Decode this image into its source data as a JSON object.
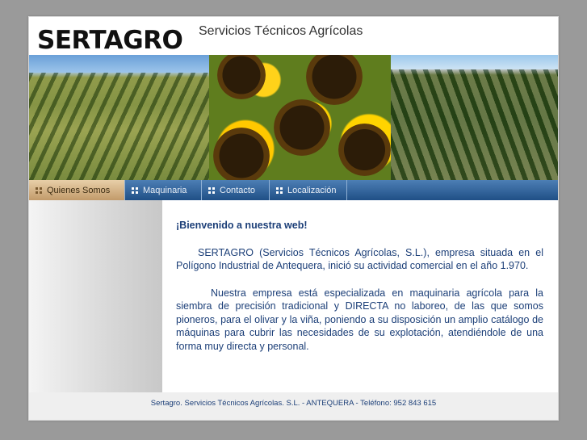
{
  "header": {
    "logo": "SERTAGRO",
    "tagline": "Servicios Técnicos Agrícolas"
  },
  "nav": {
    "items": [
      {
        "label": "Quienes Somos",
        "active": true
      },
      {
        "label": "Maquinaria",
        "active": false
      },
      {
        "label": "Contacto",
        "active": false
      },
      {
        "label": "Localización",
        "active": false
      }
    ]
  },
  "content": {
    "welcome": "¡Bienvenido a nuestra web!",
    "paragraph1": "SERTAGRO (Servicios Técnicos Agrícolas, S.L.), empresa situada en el Polígono Industrial de Antequera, inició su actividad comercial en el año 1.970.",
    "paragraph2": "Nuestra empresa está especializada en maquinaria agrícola para la siembra de precisión tradicional y DIRECTA no laboreo, de las que somos pioneros, para el olivar y la viña, poniendo a su disposición un amplio catálogo de máquinas para cubrir las necesidades de su explotación, atendiéndole de una forma muy directa y personal."
  },
  "footer": {
    "text": "Sertagro. Servicios Técnicos Agrícolas. S.L. - ANTEQUERA - Teléfono: 952 843 615"
  },
  "colors": {
    "nav_gradient_top": "#4d7fb5",
    "nav_gradient_bottom": "#1f4f86",
    "active_tab": "#c29a6a",
    "text_blue": "#1c3f78"
  },
  "banner": {
    "images": [
      "olive-grove-photo",
      "sunflowers-photo",
      "vineyard-photo"
    ]
  }
}
